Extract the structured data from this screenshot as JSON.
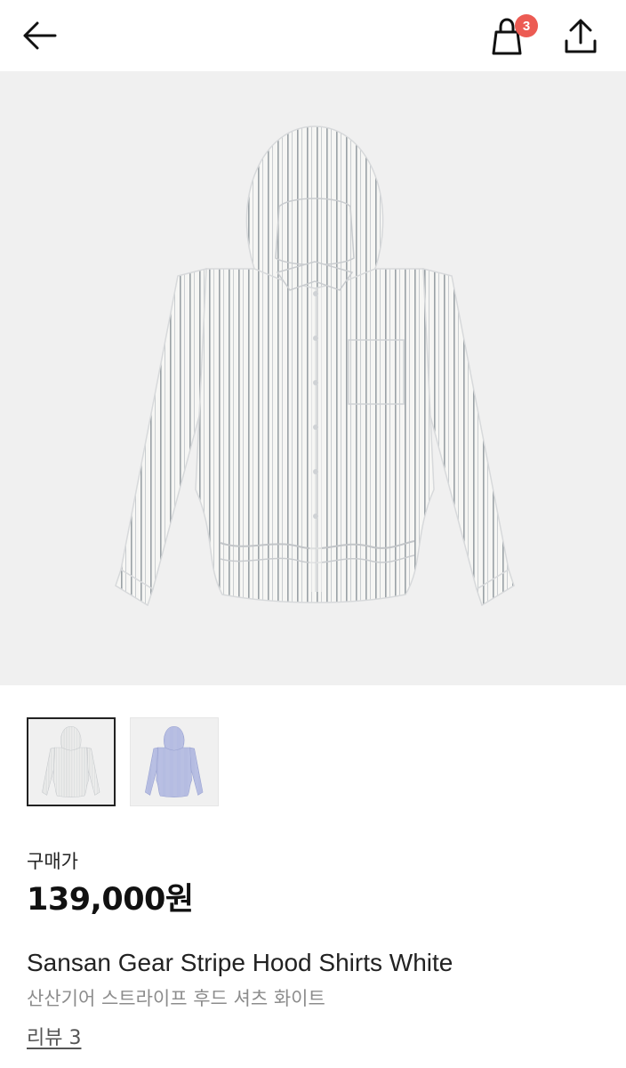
{
  "header": {
    "cart_badge_count": "3",
    "icons": {
      "back": "arrow-left-icon",
      "cart": "shopping-bag-icon",
      "share": "share-icon"
    }
  },
  "product": {
    "image_alt": "striped hooded shirt",
    "thumbnails": [
      {
        "name": "white stripe",
        "selected": true
      },
      {
        "name": "blue stripe",
        "selected": false
      }
    ],
    "price_label": "구매가",
    "price": "139,000원",
    "name_en": "Sansan Gear Stripe Hood Shirts White",
    "name_ko": "산산기어 스트라이프 후드 셔츠 화이트",
    "reviews_label": "리뷰 3"
  },
  "colors": {
    "badge": "#ec5b53",
    "image_bg": "#f0f0f0",
    "shirt_white": "#f6f6f4",
    "shirt_stripe": "#9aa1a6",
    "shirt_blue": "#b5bde0"
  }
}
